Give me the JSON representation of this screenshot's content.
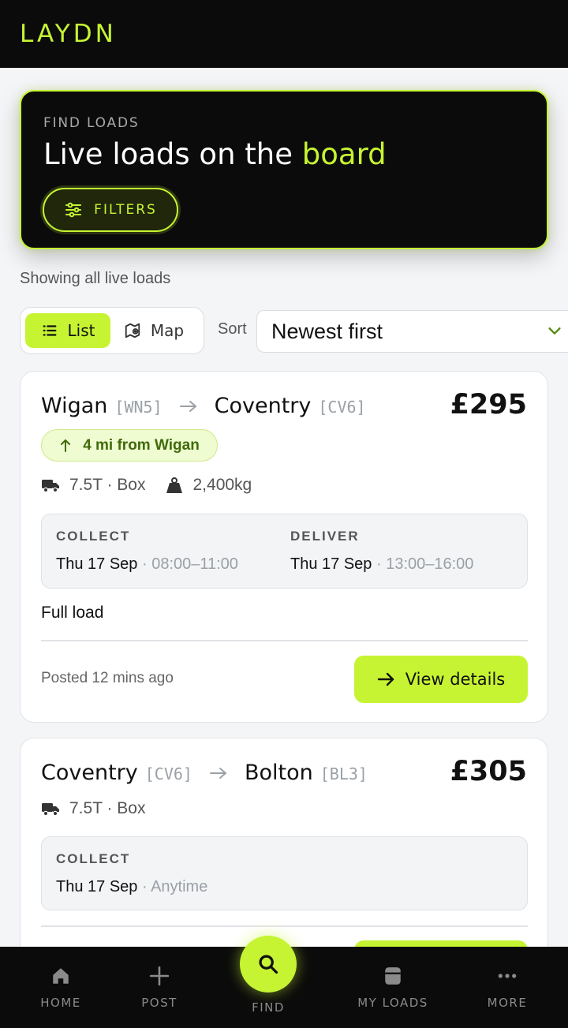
{
  "app": {
    "logo": "LAYDN",
    "accent_color": "#c6f432"
  },
  "hero": {
    "kicker": "FIND LOADS",
    "title_prefix": "Live loads on the ",
    "title_accent": "board",
    "filters_label": "FILTERS",
    "filters_icon": "sliders-icon"
  },
  "status_text": "Showing all live loads",
  "view_toggle": {
    "options": [
      {
        "label": "List",
        "icon": "list-icon",
        "active": true
      },
      {
        "label": "Map",
        "icon": "map-icon",
        "active": false
      }
    ]
  },
  "sort": {
    "label": "Sort",
    "selected": "Newest first"
  },
  "loads": [
    {
      "from_city": "Wigan",
      "from_code": "[WN5]",
      "to_city": "Coventry",
      "to_code": "[CV6]",
      "price": "£295",
      "distance_badge": "4 mi from Wigan",
      "vehicle": "7.5T · Box",
      "weight": "2,400kg",
      "collect": {
        "heading": "COLLECT",
        "date": "Thu 17 Sep",
        "time": " · 08:00–11:00"
      },
      "deliver": {
        "heading": "DELIVER",
        "date": "Thu 17 Sep",
        "time": " · 13:00–16:00"
      },
      "load_type": "Full load",
      "posted": "Posted 12 mins ago",
      "action_label": "View details"
    },
    {
      "from_city": "Coventry",
      "from_code": "[CV6]",
      "to_city": "Bolton",
      "to_code": "[BL3]",
      "price": "£305",
      "vehicle": "7.5T · Box",
      "collect": {
        "heading": "COLLECT",
        "date": "Thu 17 Sep",
        "time": " · Anytime"
      }
    }
  ],
  "bottom_nav": {
    "items": [
      {
        "label": "HOME",
        "icon": "home-icon"
      },
      {
        "label": "POST",
        "icon": "plus-icon"
      },
      {
        "label": "FIND",
        "icon": "search-icon"
      },
      {
        "label": "MY LOADS",
        "icon": "box-icon"
      },
      {
        "label": "MORE",
        "icon": "more-icon"
      }
    ]
  }
}
